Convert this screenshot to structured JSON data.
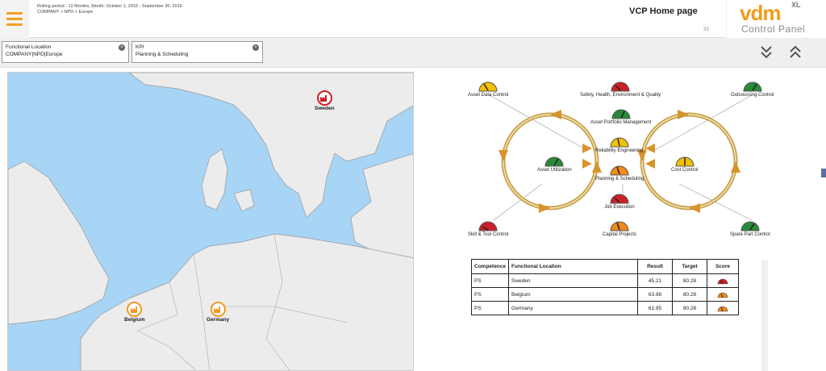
{
  "header": {
    "period_line1": "Rolling period - 12 Months, Month: October 1, 2015 - September 30, 2016",
    "period_line2": "COMPANY > NPD > Europe",
    "page_title": "VCP Home page",
    "user_badge": "33",
    "logo_main": "vdm",
    "logo_sup": "XL",
    "logo_sub": "Control Panel"
  },
  "filters": [
    {
      "label": "Functional Location",
      "value": "COMPANY|NPD|Europe"
    },
    {
      "label": "KPI",
      "value": "Planning & Scheduling"
    }
  ],
  "icons": {
    "menu": "hamburger-menu-icon",
    "clear": "clear-icon",
    "collapse": "chevrons-down-icon",
    "expand": "chevrons-up-icon",
    "factory": "factory-icon",
    "gauge": "gauge-icon"
  },
  "colors": {
    "accent": "#f39b1a",
    "sea": "#a8d4f5",
    "land": "#ececec",
    "gauge_red": "#cc2027",
    "gauge_green": "#2a8a3a",
    "gauge_yellow": "#f2c200",
    "gauge_orange": "#f08a1a",
    "ring": "#c8a250"
  },
  "map": {
    "markers": [
      {
        "name": "Sweden",
        "status": "red"
      },
      {
        "name": "Belgium",
        "status": "orange"
      },
      {
        "name": "Germany",
        "status": "orange"
      }
    ]
  },
  "kpis": [
    {
      "label": "Asset Data Control",
      "status": "yellow"
    },
    {
      "label": "Safety, Health, Environment & Quality",
      "status": "red"
    },
    {
      "label": "Outsourcing Control",
      "status": "green"
    },
    {
      "label": "Asset Portfolio Management",
      "status": "green"
    },
    {
      "label": "Reliability Engineering",
      "status": "yellow"
    },
    {
      "label": "Asset Utilization",
      "status": "green"
    },
    {
      "label": "Planning & Scheduling",
      "status": "orange"
    },
    {
      "label": "Cost Control",
      "status": "yellow"
    },
    {
      "label": "Job Execution",
      "status": "red"
    },
    {
      "label": "Skill & Tool Control",
      "status": "red"
    },
    {
      "label": "Capital Projects",
      "status": "orange"
    },
    {
      "label": "Spare Part Control",
      "status": "green"
    }
  ],
  "table": {
    "headers": [
      "Competence",
      "Functional Location",
      "Result",
      "Target",
      "Score"
    ],
    "rows": [
      {
        "competence": "PS",
        "location": "Sweden",
        "result": "45.21",
        "target": "80.28",
        "score": "red"
      },
      {
        "competence": "PS",
        "location": "Belgium",
        "result": "63.98",
        "target": "80.28",
        "score": "orange"
      },
      {
        "competence": "PS",
        "location": "Germany",
        "result": "61.95",
        "target": "80.28",
        "score": "orange"
      }
    ]
  }
}
